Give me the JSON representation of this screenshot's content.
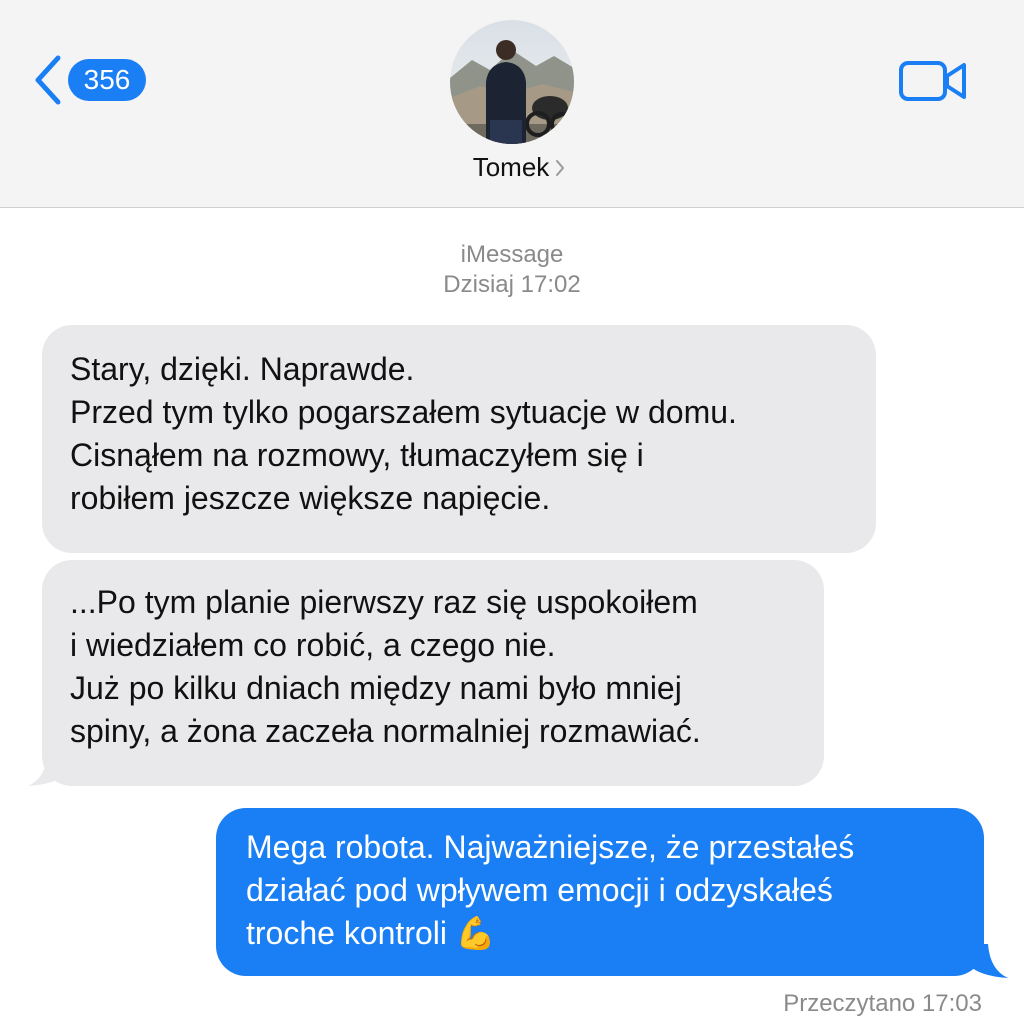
{
  "header": {
    "back_count": "356",
    "contact_name": "Tomek"
  },
  "thread": {
    "service": "iMessage",
    "timestamp": "Dzisiaj 17:02"
  },
  "messages": [
    {
      "direction": "incoming",
      "lines": [
        "Stary, dzięki. Naprawde.",
        "Przed tym tylko pogarszałem sytuacje w domu.",
        "Cisnąłem na rozmowy, tłumaczyłem się i",
        "robiłem jeszcze większe napięcie."
      ]
    },
    {
      "direction": "incoming",
      "lines": [
        "...Po tym planie pierwszy raz się uspokoiłem",
        "i wiedziałem co robić, a czego nie.",
        "Już po kilku dniach między nami było mniej",
        "spiny, a żona zaczeła normalniej rozmawiać."
      ]
    },
    {
      "direction": "outgoing",
      "lines": [
        "Mega robota. Najważniejsze, że przestałeś",
        "działać pod wpływem emocji i odzyskałeś",
        "troche kontroli 💪"
      ]
    }
  ],
  "status": {
    "read_receipt": "Przeczytano 17:03"
  },
  "colors": {
    "accent": "#1a7ff4",
    "incoming_bubble": "#e9e9eb",
    "header_bg": "#f4f4f4",
    "meta_text": "#8a8a8a"
  },
  "icons": [
    "chevron-left-icon",
    "video-camera-icon",
    "chevron-right-icon"
  ]
}
